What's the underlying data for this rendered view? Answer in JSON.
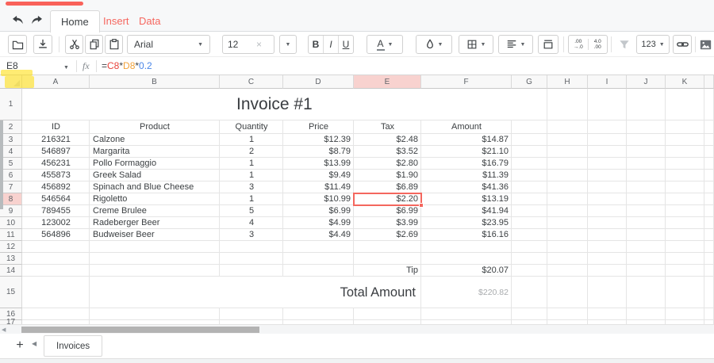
{
  "app": {
    "accent_color": "#f9625a"
  },
  "nav_tabs": {
    "items": [
      {
        "label": "Home",
        "active": true
      },
      {
        "label": "Insert",
        "active": false
      },
      {
        "label": "Data",
        "active": false
      }
    ]
  },
  "toolbar": {
    "font_family_value": "Arial",
    "font_size_value": "12",
    "bold": "B",
    "italic": "I",
    "underline": "U",
    "text_color": "A",
    "number_format": "123",
    "decimal_decrease": {
      "top": ".00",
      "bottom": "→.0"
    },
    "decimal_increase": {
      "top": "4.0",
      "bottom": ".00"
    }
  },
  "formula_bar": {
    "name_box": "E8",
    "fx": "fx",
    "formula": [
      {
        "text": "=",
        "color": "#3c4043"
      },
      {
        "text": "C8",
        "color": "#e8443c"
      },
      {
        "text": "*",
        "color": "#3c4043"
      },
      {
        "text": "D8",
        "color": "#f2a33a"
      },
      {
        "text": "*",
        "color": "#3c4043"
      },
      {
        "text": "0.2",
        "color": "#4a86e8"
      }
    ]
  },
  "grid": {
    "column_letters": [
      "A",
      "B",
      "C",
      "D",
      "E",
      "F",
      "G",
      "H",
      "I",
      "J",
      "K"
    ],
    "visible_rows": 17,
    "selected_column": "E",
    "selected_row": 8,
    "selected_cell": "E8",
    "title": "Invoice #1",
    "table": {
      "headers": [
        "ID",
        "Product",
        "Quantity",
        "Price",
        "Tax",
        "Amount"
      ],
      "rows": [
        [
          "216321",
          "Calzone",
          "1",
          "$12.39",
          "$2.48",
          "$14.87"
        ],
        [
          "546897",
          "Margarita",
          "2",
          "$8.79",
          "$3.52",
          "$21.10"
        ],
        [
          "456231",
          "Pollo Formaggio",
          "1",
          "$13.99",
          "$2.80",
          "$16.79"
        ],
        [
          "455873",
          "Greek Salad",
          "1",
          "$9.49",
          "$1.90",
          "$11.39"
        ],
        [
          "456892",
          "Spinach and Blue Cheese",
          "3",
          "$11.49",
          "$6.89",
          "$41.36"
        ],
        [
          "546564",
          "Rigoletto",
          "1",
          "$10.99",
          "$2.20",
          "$13.19"
        ],
        [
          "789455",
          "Creme Brulee",
          "5",
          "$6.99",
          "$6.99",
          "$41.94"
        ],
        [
          "123002",
          "Radeberger Beer",
          "4",
          "$4.99",
          "$3.99",
          "$23.95"
        ],
        [
          "564896",
          "Budweiser Beer",
          "3",
          "$4.49",
          "$2.69",
          "$16.16"
        ]
      ]
    },
    "tip_label": "Tip",
    "tip_value": "$20.07",
    "total_label": "Total Amount",
    "total_value": "$220.82"
  },
  "sheet_bar": {
    "tabs": [
      {
        "label": "Invoices",
        "active": true
      }
    ]
  },
  "colors": {
    "selection": "#f4675e",
    "selected_header_bg": "#f8d2cf",
    "accent_text": "#f6675f",
    "formula_ref1": "#e8443c",
    "formula_ref2": "#f2a33a",
    "formula_number": "#4a86e8"
  }
}
